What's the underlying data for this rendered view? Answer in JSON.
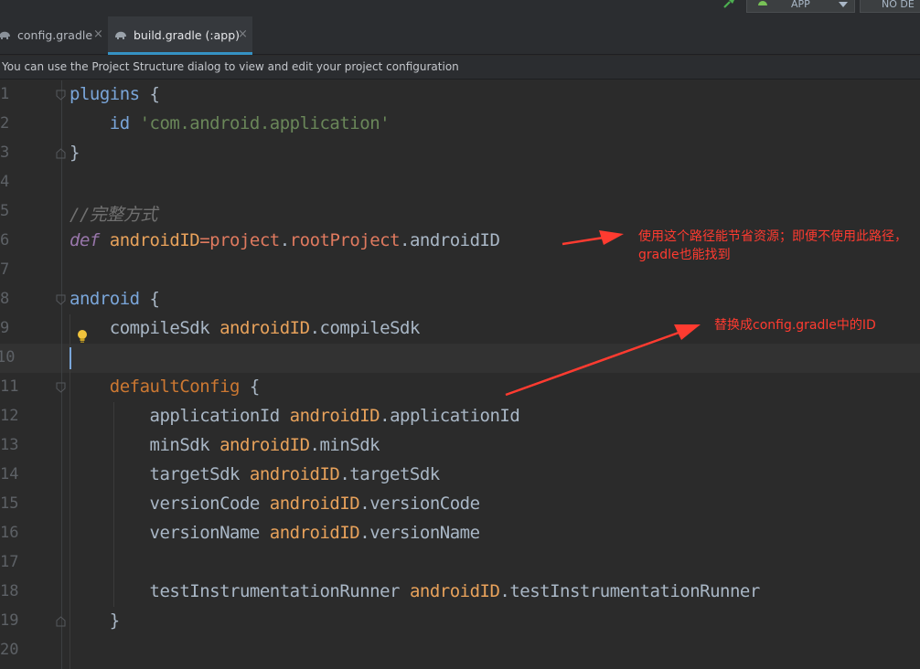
{
  "toolbar": {
    "run_config_label": "APP",
    "device_label": "NO DE"
  },
  "tabs": [
    {
      "label": "config.gradle",
      "active": false
    },
    {
      "label": "build.gradle (:app)",
      "active": true
    }
  ],
  "close_glyph": "×",
  "banner": {
    "text": "You can use the Project Structure dialog to view and edit your project configuration"
  },
  "editor": {
    "line_numbers": [
      "1",
      "2",
      "3",
      "4",
      "5",
      "6",
      "7",
      "8",
      "9",
      "10",
      "11",
      "12",
      "13",
      "14",
      "15",
      "16",
      "17",
      "18",
      "19",
      "20"
    ],
    "current_line": 10,
    "code": {
      "l1_kw": "plugins",
      "l1_brace": " {",
      "l2_id": "id ",
      "l2_str": "'com.android.application'",
      "l3": "}",
      "l5_comment": "//完整方式",
      "l6_def": "def ",
      "l6_name": "androidID",
      "l6_eq": "=",
      "l6_project": "project",
      "l6_dot1": ".",
      "l6_root": "rootProject",
      "l6_rest": ".androidID",
      "l8_kw": "android",
      "l8_brace": " {",
      "l9_prop": "compileSdk ",
      "l9_var": "androidID",
      "l9_rest": ".compileSdk",
      "l11_kw": "defaultConfig",
      "l11_brace": " {",
      "l12_prop": "applicationId ",
      "l12_var": "androidID",
      "l12_rest": ".applicationId",
      "l13_prop": "minSdk ",
      "l13_var": "androidID",
      "l13_rest": ".minSdk",
      "l14_prop": "targetSdk ",
      "l14_var": "androidID",
      "l14_rest": ".targetSdk",
      "l15_prop": "versionCode ",
      "l15_var": "androidID",
      "l15_rest": ".versionCode",
      "l16_prop": "versionName ",
      "l16_var": "androidID",
      "l16_rest": ".versionName",
      "l18_prop": "testInstrumentationRunner ",
      "l18_var": "androidID",
      "l18_rest": ".testInstrumentationRunner",
      "l19": "}"
    }
  },
  "annotations": {
    "note1": "使用这个路径能节省资源；即便不使用此路径，gradle也能找到",
    "note2": "替换成config.gradle中的ID"
  },
  "colors": {
    "annotation_red": "#ff3b30",
    "tab_active_underline": "#3592c4",
    "keyword": "#cc7832",
    "string": "#6a8759",
    "variable": "#e8a25b"
  }
}
